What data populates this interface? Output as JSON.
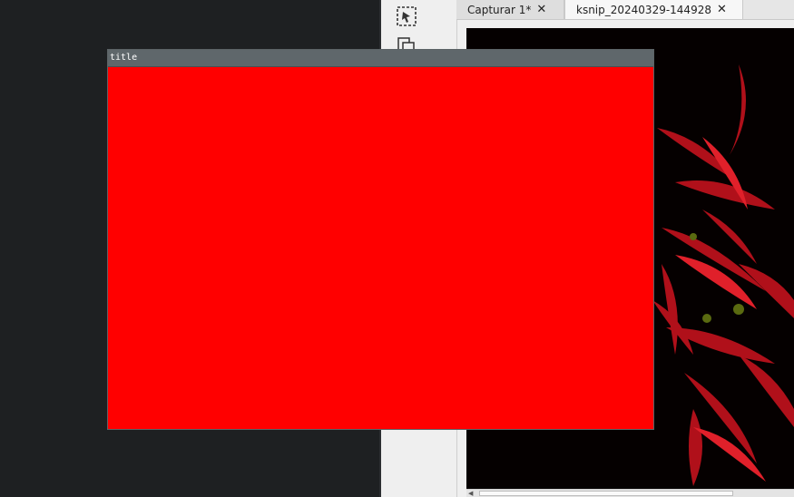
{
  "tabs": [
    {
      "label": "Capturar 1*",
      "close": "✕",
      "active": false
    },
    {
      "label": "ksnip_20240329-144928",
      "close": "✕",
      "active": true
    }
  ],
  "popup": {
    "title": "title",
    "fill_color": "#ff0000"
  },
  "toolbar": {
    "icons": [
      "select-region-icon",
      "copy-icon"
    ]
  },
  "canvas": {
    "image_subject": "red spider lily flowers on black background"
  }
}
